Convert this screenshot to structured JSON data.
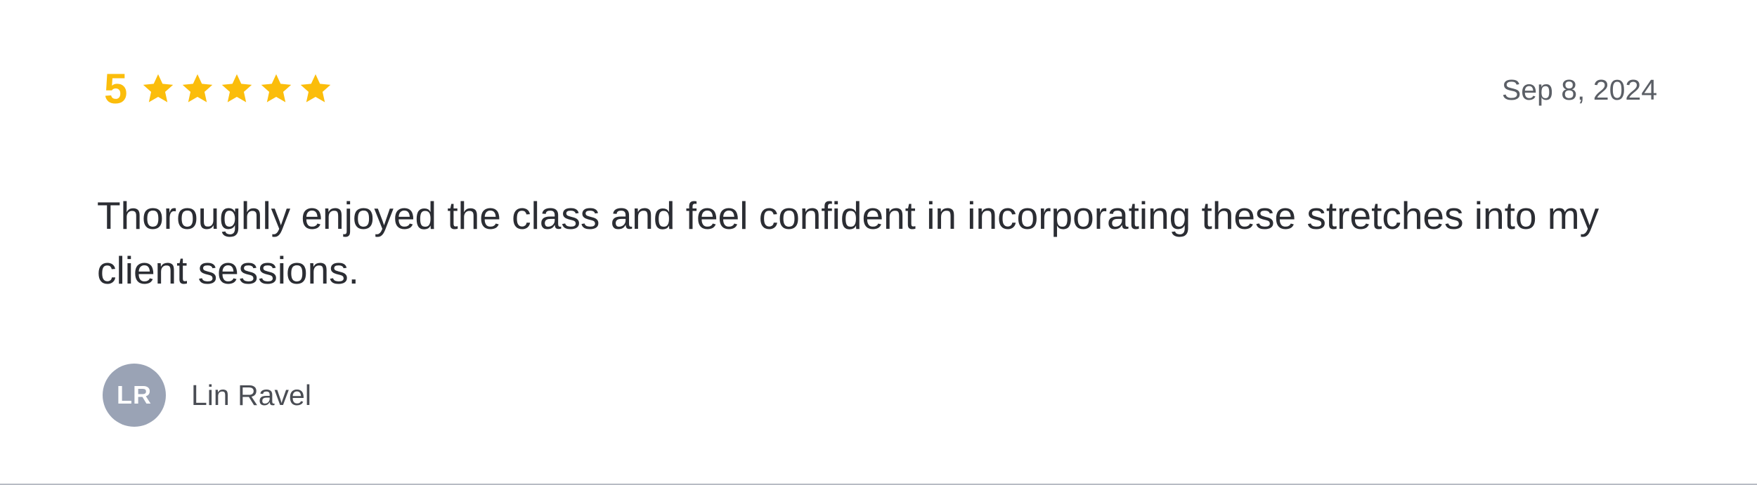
{
  "review": {
    "rating": {
      "value": "5",
      "stars_filled": 5,
      "stars_total": 5,
      "color": "#fbbd0b"
    },
    "date": "Sep 8, 2024",
    "text": "Thoroughly enjoyed the class and feel confident in incorporating these stretches into my client sessions.",
    "author": {
      "initials": "LR",
      "name": "Lin Ravel",
      "avatar_color": "#9aa3b5"
    },
    "icons": {
      "star": "star-icon"
    }
  }
}
